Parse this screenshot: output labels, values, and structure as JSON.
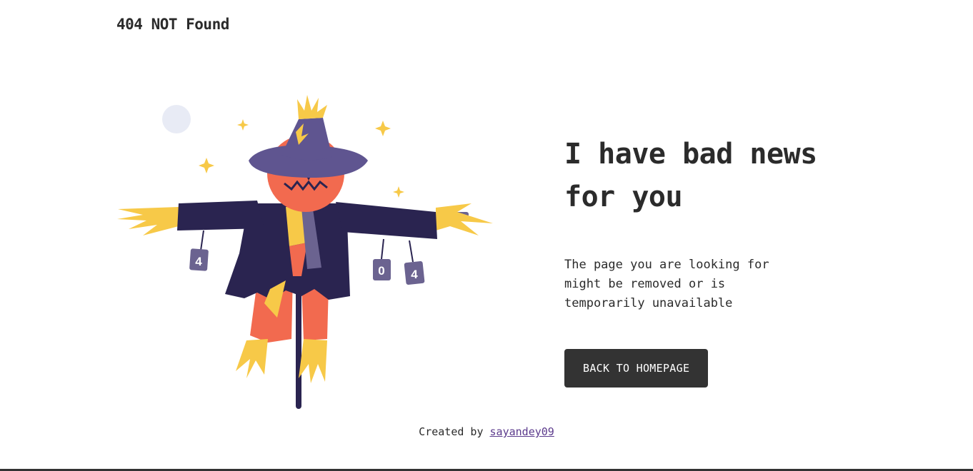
{
  "header": {
    "title": "404 NOT Found"
  },
  "main": {
    "headline": "I have bad news for you",
    "message": "The page you are looking for might be removed or is temporarily unavailable",
    "back_button_label": "BACK TO HOMEPAGE",
    "illustration": {
      "icon": "scarecrow-illustration",
      "can_digits": [
        "4",
        "0",
        "4"
      ]
    }
  },
  "footer": {
    "prefix": "Created by",
    "author_link": "sayandey09"
  },
  "colors": {
    "text": "#2b2b2b",
    "button_bg": "#333333",
    "button_text": "#ffffff",
    "hat": "#5f5590",
    "coat": "#2a2450",
    "skin": "#f26a4f",
    "straw": "#f7c948",
    "link": "#5b3a8c"
  }
}
